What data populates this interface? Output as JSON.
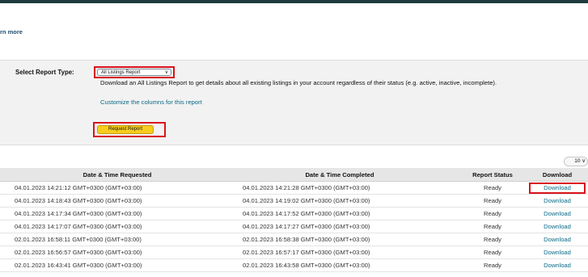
{
  "header": {
    "learn_more": "rn more"
  },
  "report_panel": {
    "select_label": "Select Report Type:",
    "select_value": "All Listings Report",
    "description": "Download an All Listings Report to get details about all existing listings in your account regardless of their status (e.g. active, inactive, incomplete).",
    "customize_link": "Customize the columns for this report",
    "request_button": "Request Report"
  },
  "pager": {
    "page_size": "10 ∨"
  },
  "table": {
    "columns": [
      "Date & Time Requested",
      "Date & Time Completed",
      "Report Status",
      "Download"
    ],
    "rows": [
      {
        "requested": "04.01.2023 14:21:12 GMT+0300 (GMT+03:00)",
        "completed": "04.01.2023 14:21:28 GMT+0300 (GMT+03:00)",
        "status": "Ready",
        "download": "Download"
      },
      {
        "requested": "04.01.2023 14:18:43 GMT+0300 (GMT+03:00)",
        "completed": "04.01.2023 14:19:02 GMT+0300 (GMT+03:00)",
        "status": "Ready",
        "download": "Download"
      },
      {
        "requested": "04.01.2023 14:17:34 GMT+0300 (GMT+03:00)",
        "completed": "04.01.2023 14:17:52 GMT+0300 (GMT+03:00)",
        "status": "Ready",
        "download": "Download"
      },
      {
        "requested": "04.01.2023 14:17:07 GMT+0300 (GMT+03:00)",
        "completed": "04.01.2023 14:17:27 GMT+0300 (GMT+03:00)",
        "status": "Ready",
        "download": "Download"
      },
      {
        "requested": "02.01.2023 16:58:11 GMT+0300 (GMT+03:00)",
        "completed": "02.01.2023 16:58:38 GMT+0300 (GMT+03:00)",
        "status": "Ready",
        "download": "Download"
      },
      {
        "requested": "02.01.2023 16:56:57 GMT+0300 (GMT+03:00)",
        "completed": "02.01.2023 16:57:17 GMT+0300 (GMT+03:00)",
        "status": "Ready",
        "download": "Download"
      },
      {
        "requested": "02.01.2023 16:43:41 GMT+0300 (GMT+03:00)",
        "completed": "02.01.2023 16:43:58 GMT+0300 (GMT+03:00)",
        "status": "Ready",
        "download": "Download"
      }
    ]
  },
  "colors": {
    "accent_link": "#0a6a87",
    "highlight_border": "#d9141c",
    "button_yellow": "#f6cd1e",
    "top_bar": "#1e3b3f"
  }
}
